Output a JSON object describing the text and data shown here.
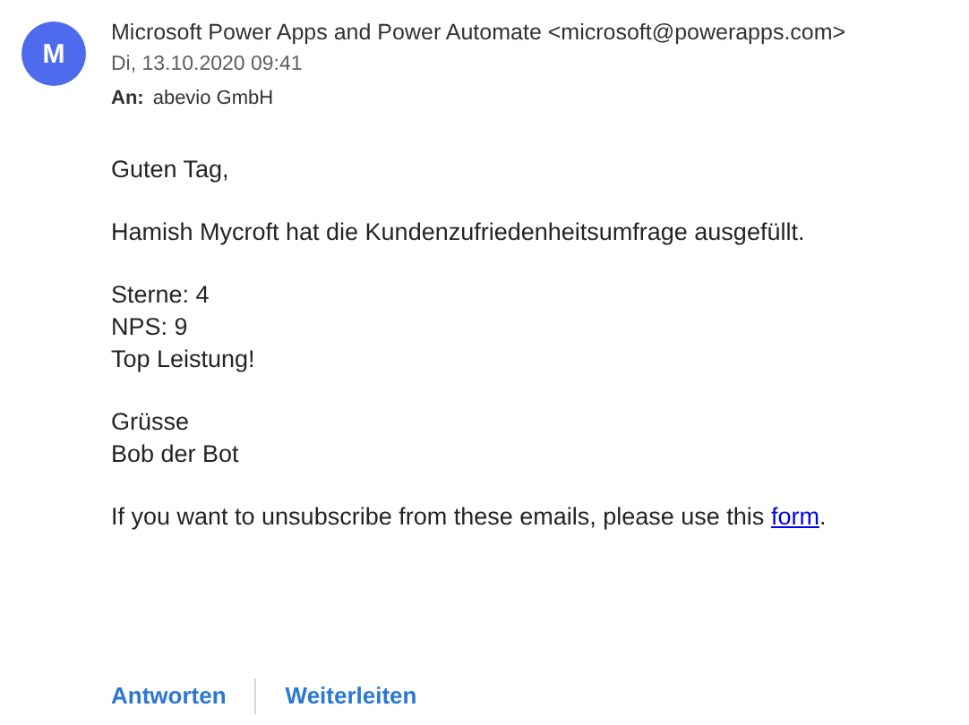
{
  "sender": {
    "avatar_letter": "M",
    "name": "Microsoft Power Apps and Power Automate <microsoft@powerapps.com>",
    "date": "Di, 13.10.2020 09:41",
    "to_label": "An:",
    "to": "abevio GmbH"
  },
  "body": [
    [
      "Guten Tag,"
    ],
    [
      "Hamish Mycroft hat die Kundenzufriedenheitsumfrage ausgefüllt."
    ],
    [
      "Sterne: 4",
      "NPS: 9",
      "Top Leistung!"
    ],
    [
      "Grüsse",
      "Bob der Bot"
    ]
  ],
  "unsubscribe": {
    "text": "If you want to unsubscribe from these emails, please use this",
    "link": "form",
    "after": "."
  },
  "actions": [
    "Antworten",
    "Weiterleiten"
  ]
}
